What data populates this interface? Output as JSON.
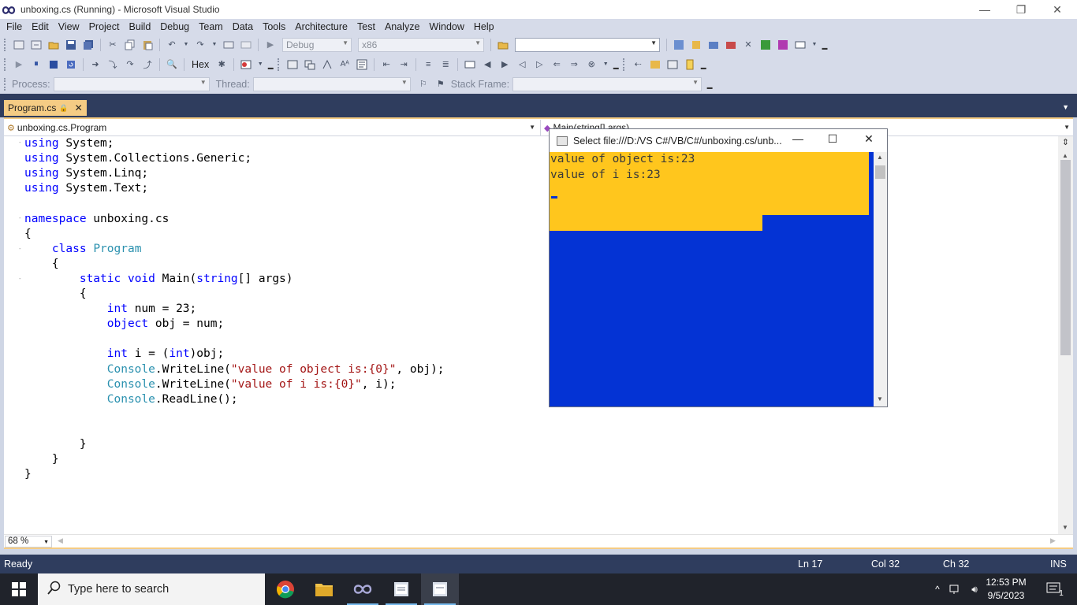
{
  "window": {
    "title": "unboxing.cs (Running) - Microsoft Visual Studio",
    "minimize_glyph": "—",
    "restore_glyph": "❐",
    "close_glyph": "✕"
  },
  "menu": [
    "File",
    "Edit",
    "View",
    "Project",
    "Build",
    "Debug",
    "Team",
    "Data",
    "Tools",
    "Architecture",
    "Test",
    "Analyze",
    "Window",
    "Help"
  ],
  "toolbar": {
    "configuration": "Debug",
    "platform": "x86",
    "find_value": "",
    "hex_label": "Hex",
    "process_label": "Process:",
    "thread_label": "Thread:",
    "stack_frame_label": "Stack Frame:"
  },
  "document_tab": {
    "label": "Program.cs",
    "lock_glyph": "🔒",
    "close_glyph": "✕"
  },
  "navigation": {
    "type_combo": "unboxing.cs.Program",
    "member_combo": "Main(string[] args)"
  },
  "code_lines": [
    {
      "text": "using System;"
    },
    {
      "text": "using System.Collections.Generic;"
    },
    {
      "text": "using System.Linq;"
    },
    {
      "text": "using System.Text;"
    },
    {
      "text": ""
    },
    {
      "text": "namespace unboxing.cs"
    },
    {
      "text": "{"
    },
    {
      "text": "    class Program"
    },
    {
      "text": "    {"
    },
    {
      "text": "        static void Main(string[] args)"
    },
    {
      "text": "        {"
    },
    {
      "text": "            int num = 23;"
    },
    {
      "text": "            object obj = num;"
    },
    {
      "text": ""
    },
    {
      "text": "            int i = (int)obj;"
    },
    {
      "text": "            Console.WriteLine(\"value of object is:{0}\", obj);"
    },
    {
      "text": "            Console.WriteLine(\"value of i is:{0}\", i);"
    },
    {
      "text": "            Console.ReadLine();"
    },
    {
      "text": ""
    },
    {
      "text": ""
    },
    {
      "text": "        }"
    },
    {
      "text": "    }"
    },
    {
      "text": "}"
    }
  ],
  "zoom": "68 %",
  "status": {
    "state": "Ready",
    "line": "Ln 17",
    "column": "Col 32",
    "char": "Ch 32",
    "mode": "INS"
  },
  "console": {
    "title": "Select file:///D:/VS C#/VB/C#/unboxing.cs/unb...",
    "lines": [
      "value of object is:23",
      "value of i is:23"
    ],
    "colors": {
      "background": "#0433d4",
      "highlight": "#ffc61d"
    }
  },
  "taskbar": {
    "search_placeholder": "Type here to search",
    "time": "12:53 PM",
    "date": "9/5/2023",
    "notification_count": "1",
    "apps": [
      "chrome-icon",
      "file-explorer-icon",
      "visual-studio-icon",
      "document-app-icon",
      "active-app-icon"
    ]
  },
  "colors": {
    "chrome": "#d6dbe9",
    "accent_dark": "#2f3d5e",
    "tab_active": "#f5cc84",
    "keyword": "#0000ff",
    "type": "#2b91af",
    "string": "#a31515"
  }
}
